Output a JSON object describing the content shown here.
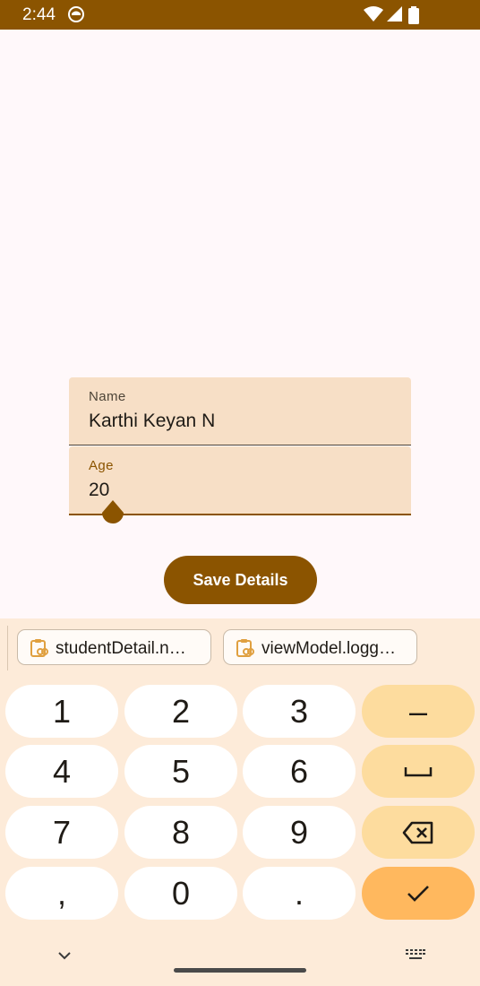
{
  "status_bar": {
    "time": "2:44",
    "icons": [
      "app-notification-icon",
      "wifi-icon",
      "cellular-icon",
      "battery-icon"
    ],
    "background": "#8B5400"
  },
  "form": {
    "name_field": {
      "label": "Name",
      "value": "Karthi Keyan N"
    },
    "age_field": {
      "label": "Age",
      "value": "20"
    },
    "save_button_label": "Save Details"
  },
  "keyboard": {
    "suggestions": [
      {
        "label": "studentDetail.n…",
        "icon": "clipboard-link-icon"
      },
      {
        "label": "viewModel.logg…",
        "icon": "clipboard-link-icon"
      }
    ],
    "keys": {
      "k1": "1",
      "k2": "2",
      "k3": "3",
      "k4": "4",
      "k5": "5",
      "k6": "6",
      "k7": "7",
      "k8": "8",
      "k9": "9",
      "comma": ",",
      "k0": "0",
      "period": ".",
      "minus": "–"
    },
    "function_icons": [
      "space-icon",
      "backspace-icon",
      "checkmark-icon"
    ]
  },
  "navigation": {
    "icons": [
      "chevron-down-icon",
      "keyboard-switch-icon"
    ]
  },
  "colors": {
    "primary": "#8B5400",
    "field_background": "#F7DFC6",
    "keyboard_background": "#FDEBD9",
    "function_key": "#FDDC9E",
    "enter_key": "#FFB85E"
  }
}
